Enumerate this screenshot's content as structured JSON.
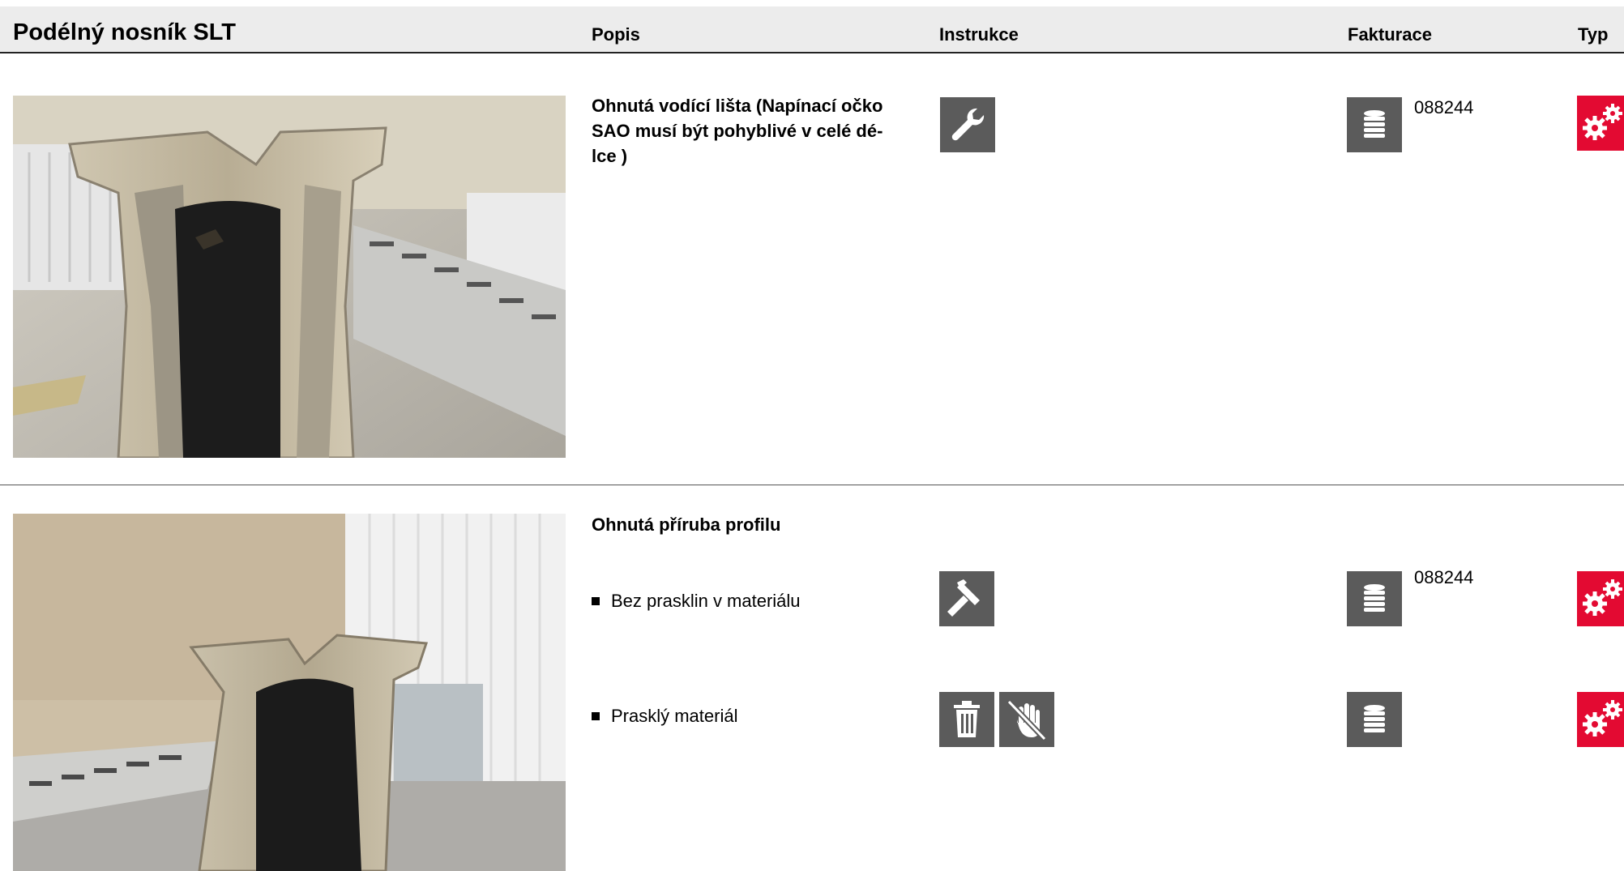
{
  "header": {
    "title": "Podélný nosník SLT",
    "col_popis": "Popis",
    "col_instrukce": "Instrukce",
    "col_fakturace": "Fakturace",
    "col_typ": "Typ"
  },
  "rows": [
    {
      "description": "Ohnutá vodící lišta (Napínací očko SAO  musí být pohyblivé v celé délce )",
      "description_lines": [
        "Ohnutá vodící lišta (Napínací očko",
        "SAO  musí být pohyblivé v celé dé-",
        "lce )"
      ],
      "instruction_icons": [
        "wrench-icon"
      ],
      "billing_icon": "coins-stack-icon",
      "billing_code": "088244",
      "type_icon": "gears-icon"
    },
    {
      "description": "Ohnutá příruba profilu",
      "items": [
        {
          "label": "Bez prasklin v materiálu",
          "instruction_icons": [
            "hammer-icon"
          ],
          "billing_icon": "coins-stack-icon",
          "billing_code": "088244",
          "type_icon": "gears-icon"
        },
        {
          "label": "Prasklý materiál",
          "instruction_icons": [
            "trash-icon",
            "no-touch-icon"
          ],
          "billing_icon": "coins-stack-icon",
          "billing_code": "",
          "type_icon": "gears-icon"
        }
      ]
    }
  ],
  "colors": {
    "header_bg": "#ececec",
    "icon_bg": "#5b5b5b",
    "type_bg": "#e30a32"
  }
}
